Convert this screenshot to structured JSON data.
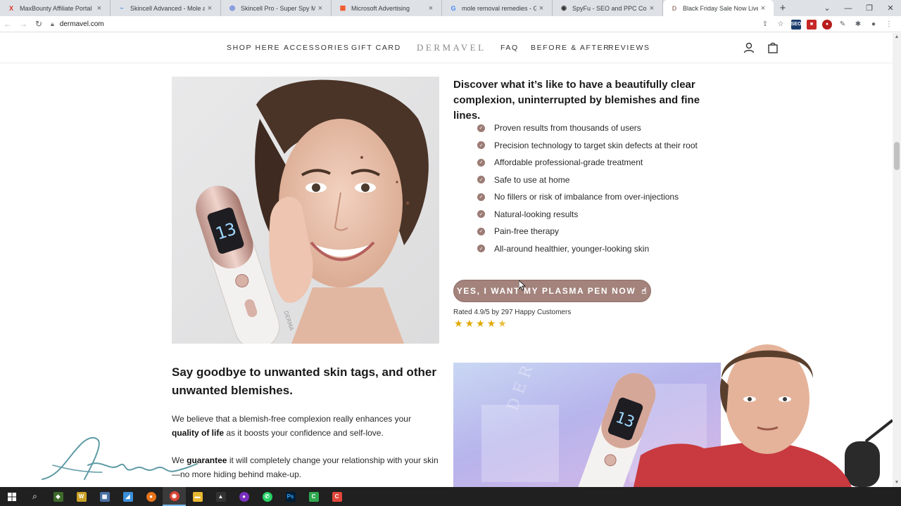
{
  "browser": {
    "tabs": [
      {
        "title": "MaxBounty Affiliate Portal",
        "icon": "maxbounty-icon",
        "color": "#d93025",
        "glyph": "X"
      },
      {
        "title": "Skincell Advanced - Mole and Sk",
        "icon": "skincell-icon",
        "color": "#4a8fd6",
        "glyph": "~"
      },
      {
        "title": "Skincell Pro - Super Spy Method",
        "icon": "spy-icon",
        "color": "#3b5bdb",
        "glyph": "◎"
      },
      {
        "title": "Microsoft Advertising",
        "icon": "microsoft-icon",
        "color": "#f25022",
        "glyph": "▦"
      },
      {
        "title": "mole removal remedies - Googl",
        "icon": "google-icon",
        "color": "#4285f4",
        "glyph": "G"
      },
      {
        "title": "SpyFu - SEO and PPC Competit",
        "icon": "spyfu-icon",
        "color": "#333333",
        "glyph": "◉"
      },
      {
        "title": "Black Friday Sale Now Live | Up",
        "icon": "dermavel-icon",
        "color": "#a3837c",
        "glyph": "D"
      }
    ],
    "url": "dermavel.com"
  },
  "nav": {
    "shop": "SHOP HERE",
    "accessories": "ACCESSORIES",
    "gift": "GIFT CARD",
    "logo": "DERMAVEL",
    "faq": "FAQ",
    "before_after": "BEFORE & AFTER",
    "reviews": "REVIEWS"
  },
  "hero": {
    "headline": "Discover what it’s like to have a beautifully clear complexion, uninterrupted by blemishes and fine lines.",
    "benefits": [
      "Proven results from thousands of users",
      "Precision technology to target skin defects at their root",
      "Affordable professional-grade treatment",
      "Safe to use at home",
      "No fillers or risk of imbalance from over-injections",
      "Natural-looking results",
      "Pain-free therapy",
      "All-around healthier, younger-looking skin"
    ],
    "cta": "YES, I WANT MY PLASMA PEN NOW",
    "rating_text": "Rated 4.9/5 by 297 Happy Customers",
    "rating_value": 4.5,
    "product_screen": "13",
    "brand_on_device": "DERMA"
  },
  "section2": {
    "title": "Say goodbye to unwanted skin tags, and other unwanted blemishes.",
    "p1_a": "We believe that a blemish-free complexion really enhances your ",
    "p1_b": "quality of life",
    "p1_c": " as it boosts your confidence and self-love.",
    "p2_a": "We ",
    "p2_b": "guarantee",
    "p2_c": " it will completely change your relationship with your skin—no more hiding behind make-up.",
    "image_watermark": "DERMAVEL"
  },
  "colors": {
    "accent": "#a3837c",
    "check": "#9b7b74",
    "star": "#e1a900",
    "taskbar": "#202020"
  }
}
